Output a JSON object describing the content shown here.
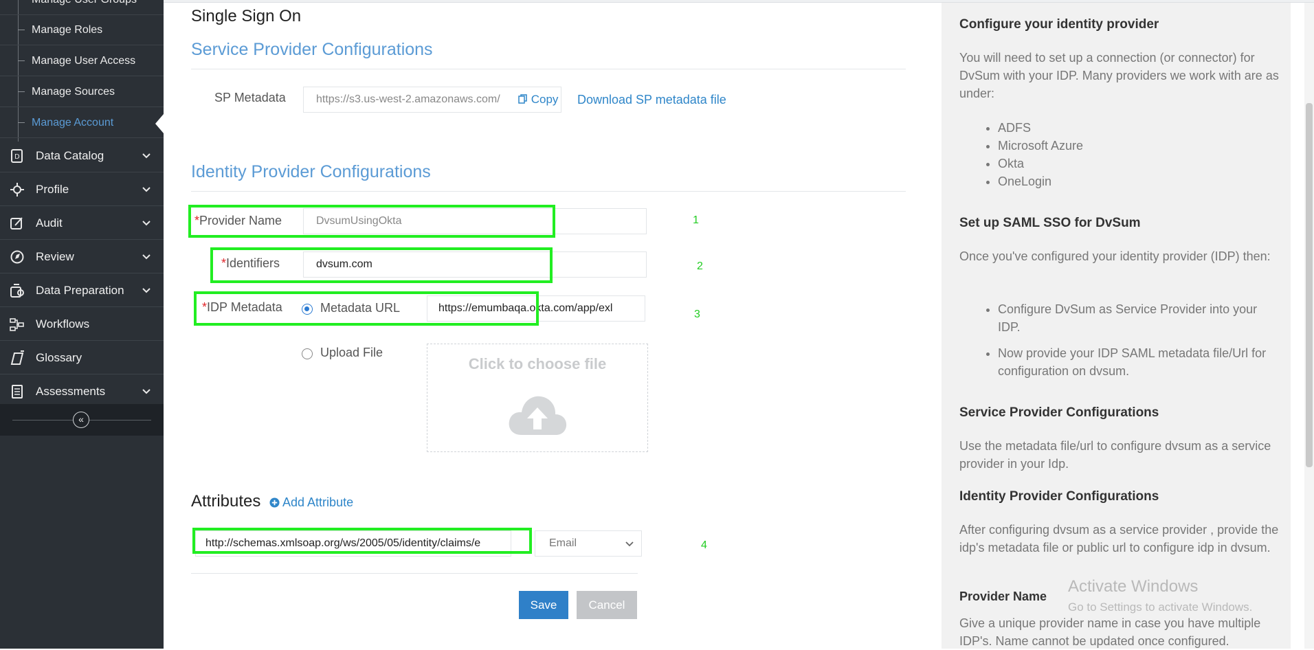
{
  "sidebar": {
    "partial_item": "Manage User Groups",
    "sub_items": [
      {
        "label": "Manage Roles"
      },
      {
        "label": "Manage User Access"
      },
      {
        "label": "Manage Sources"
      },
      {
        "label": "Manage Account",
        "active": true
      }
    ],
    "nav_items": [
      {
        "label": "Data Catalog",
        "icon": "data-catalog-icon",
        "has_chevron": true
      },
      {
        "label": "Profile",
        "icon": "profile-icon",
        "has_chevron": true
      },
      {
        "label": "Audit",
        "icon": "audit-icon",
        "has_chevron": true
      },
      {
        "label": "Review",
        "icon": "review-icon",
        "has_chevron": true
      },
      {
        "label": "Data Preparation",
        "icon": "data-preparation-icon",
        "has_chevron": true
      },
      {
        "label": "Workflows",
        "icon": "workflows-icon",
        "has_chevron": false
      },
      {
        "label": "Glossary",
        "icon": "glossary-icon",
        "has_chevron": false
      },
      {
        "label": "Assessments",
        "icon": "assessments-icon",
        "has_chevron": true
      }
    ],
    "collapse_icon": "double-chevron-left-icon"
  },
  "main": {
    "page_title": "Single Sign On",
    "sp_section": {
      "title": "Service Provider Configurations",
      "sp_metadata_label": "SP Metadata",
      "sp_metadata_value": "https://s3.us-west-2.amazonaws.com/",
      "copy_label": "Copy",
      "download_link": "Download SP metadata file"
    },
    "idp_section": {
      "title": "Identity Provider Configurations",
      "required_mark": "*",
      "provider_name_label": "Provider Name",
      "provider_name_placeholder": "DvsumUsingOkta",
      "identifiers_label": "Identifiers",
      "identifiers_value": "dvsum.com",
      "idp_metadata_label": "IDP Metadata",
      "metadata_url_option": "Metadata URL",
      "metadata_url_value": "https://emumbaqa.okta.com/app/exl",
      "upload_file_option": "Upload File",
      "upload_prompt": "Click to choose file"
    },
    "attributes": {
      "title": "Attributes",
      "add_attribute_label": "Add Attribute",
      "claim_value": "http://schemas.xmlsoap.org/ws/2005/05/identity/claims/e",
      "mapping_selected": "Email"
    },
    "buttons": {
      "save": "Save",
      "cancel": "Cancel"
    },
    "highlight_numbers": [
      "1",
      "2",
      "3",
      "4"
    ],
    "highlight_color": "#22ee22"
  },
  "help": {
    "h1": "Configure your identity provider",
    "p1": "You will need to set up a connection (or connector) for DvSum with your IDP. Many providers we work with are as under:",
    "providers": [
      "ADFS",
      "Microsoft Azure",
      "Okta",
      "OneLogin"
    ],
    "h2": "Set up SAML SSO for DvSum",
    "p2": "Once you've configured your identity provider (IDP) then:",
    "steps": [
      "Configure DvSum as Service Provider into your IDP.",
      "Now provide your IDP SAML metadata file/Url for configuration on dvsum."
    ],
    "h3": "Service Provider Configurations",
    "p3": "Use the metadata file/url to configure dvsum as a service provider in your Idp.",
    "h4": "Identity Provider Configurations",
    "p4": "After configuring dvsum as a service provider , provide the idp's metadata file or public url to configure idp in dvsum.",
    "h5": "Provider Name",
    "p5": "Give a unique provider name in case you have multiple IDP's. Name cannot be updated once configured."
  },
  "watermark": {
    "line1": "Activate Windows",
    "line2": "Go to Settings to activate Windows."
  }
}
